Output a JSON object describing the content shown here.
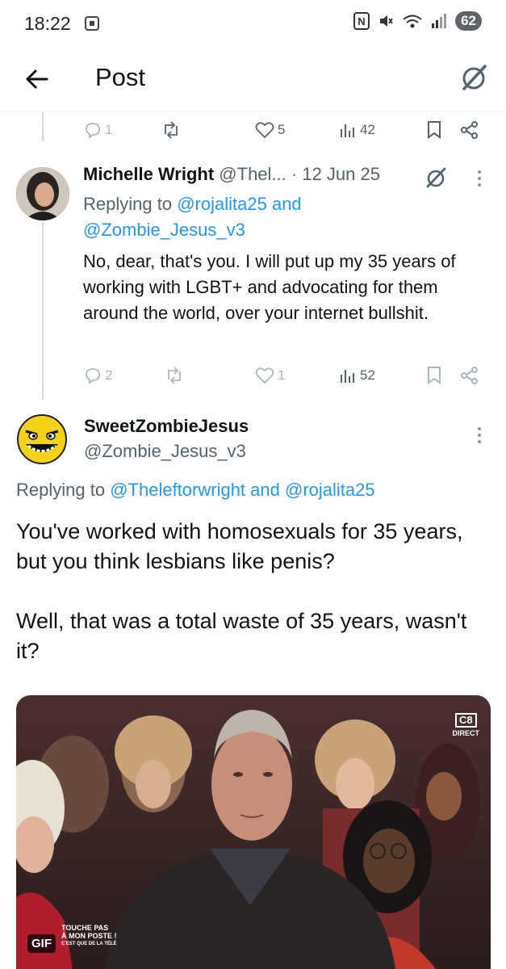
{
  "status_bar": {
    "time": "18:22",
    "battery": "62",
    "icons": [
      "nfc-icon",
      "vibrate-icon",
      "wifi-icon",
      "signal-icon"
    ]
  },
  "header": {
    "title": "Post",
    "back_icon": "back-arrow-icon",
    "grok_icon": "grok-icon"
  },
  "top_actions": {
    "replies": "1",
    "retweets": "",
    "likes": "5",
    "views": "42"
  },
  "tweet1": {
    "name": "Michelle Wright",
    "handle": "@Thel...",
    "date": "· 12 Jun 25",
    "replying_prefix": "Replying to",
    "replying_to_1": "@rojalita25",
    "replying_and": "and",
    "replying_to_2": "@Zombie_Jesus_v3",
    "text": "No, dear, that's you. I will put up my 35 years of working with LGBT+ and advocating for them around the world, over your internet bullshit.",
    "actions": {
      "replies": "2",
      "retweets": "",
      "likes": "1",
      "views": "52"
    }
  },
  "tweet2": {
    "name": "SweetZombieJesus",
    "handle": "@Zombie_Jesus_v3",
    "replying_prefix": "Replying to",
    "replying_to_1": "@Theleftorwright",
    "replying_and": "and",
    "replying_to_2": "@rojalita25",
    "text": "You've worked with homosexuals for 35 years, but you think lesbians like penis?\n\nWell, that was a total waste of 35 years, wasn't it?",
    "media": {
      "badge": "GIF",
      "channel": "C8",
      "channel_sub": "DIRECT",
      "show_logo_line1": "TOUCHE PAS",
      "show_logo_line2": "À MON POSTE !",
      "show_logo_line3": "C'EST QUE DE LA TÉLÉ"
    }
  },
  "colors": {
    "accent": "#1d9bf0",
    "text": "#0f1419",
    "secondary": "#536471",
    "divider": "#eff3f4"
  }
}
